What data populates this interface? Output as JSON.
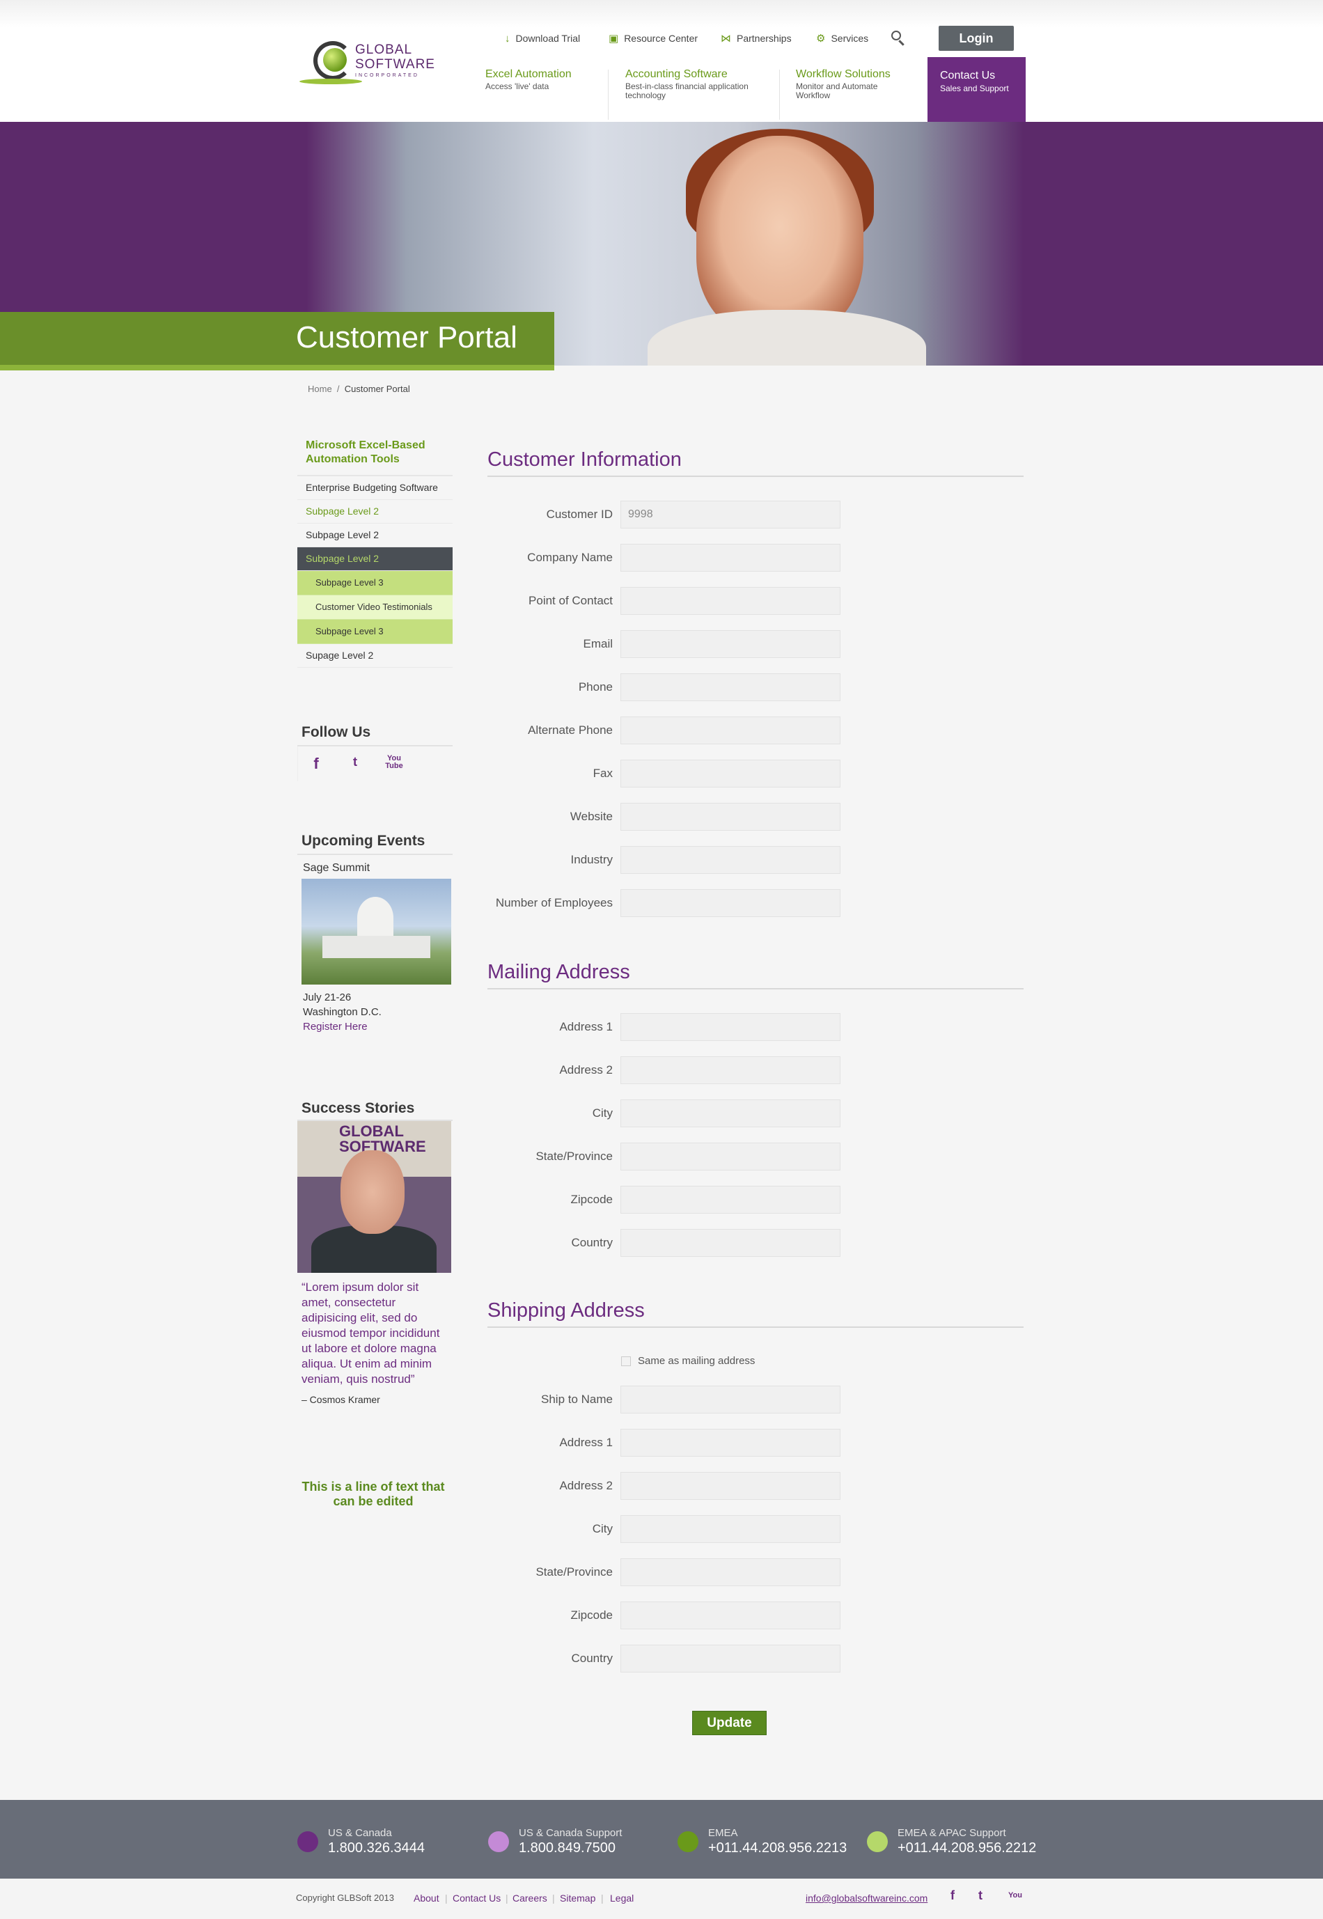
{
  "header": {
    "logo": {
      "line1": "GLOBAL",
      "line2": "SOFTWARE",
      "line3": "INCORPORATED"
    },
    "top_links": [
      {
        "label": "Download Trial",
        "icon": "download-icon"
      },
      {
        "label": "Resource Center",
        "icon": "box-icon"
      },
      {
        "label": "Partnerships",
        "icon": "handshake-icon"
      },
      {
        "label": "Services",
        "icon": "gears-icon"
      }
    ],
    "login_label": "Login",
    "nav": [
      {
        "title": "Excel Automation",
        "sub": "Access 'live' data"
      },
      {
        "title": "Accounting Software",
        "sub": "Best-in-class financial application technology"
      },
      {
        "title": "Workflow Solutions",
        "sub": "Monitor and Automate Workflow"
      },
      {
        "title": "Contact Us",
        "sub": "Sales and Support"
      }
    ]
  },
  "hero": {
    "title": "Customer Portal"
  },
  "breadcrumb": {
    "home": "Home",
    "sep": "/",
    "current": "Customer Portal"
  },
  "sidebar": {
    "heading": "Microsoft Excel-Based Automation Tools",
    "items": [
      {
        "label": "Enterprise Budgeting Software"
      },
      {
        "label": "Subpage Level 2"
      },
      {
        "label": "Subpage Level 2"
      },
      {
        "label": "Subpage Level 2"
      },
      {
        "label": "Subpage Level 3"
      },
      {
        "label": "Customer Video Testimonials"
      },
      {
        "label": "Subpage Level 3"
      },
      {
        "label": "Supage Level 2"
      }
    ],
    "follow": {
      "title": "Follow Us",
      "facebook": "f",
      "twitter": "t",
      "youtube_top": "You",
      "youtube_bottom": "Tube"
    },
    "events": {
      "title": "Upcoming Events",
      "name": "Sage Summit",
      "date": "July 21-26",
      "location": "Washington D.C.",
      "link": "Register Here"
    },
    "stories": {
      "title": "Success Stories",
      "banner": "GLOBAL SOFTWARE",
      "quote": "“Lorem ipsum dolor sit amet, consectetur adipisicing elit, sed do eiusmod tempor incididunt ut labore et dolore magna aliqua. Ut enim ad minim veniam, quis nostrud”",
      "author": "– Cosmos Kramer"
    },
    "editable_line": "This is a line of text that can be edited"
  },
  "form": {
    "customer": {
      "title": "Customer Information",
      "fields": [
        {
          "label": "Customer ID",
          "value": "9998"
        },
        {
          "label": "Company Name",
          "value": ""
        },
        {
          "label": "Point of Contact",
          "value": ""
        },
        {
          "label": "Email",
          "value": ""
        },
        {
          "label": "Phone",
          "value": ""
        },
        {
          "label": "Alternate Phone",
          "value": ""
        },
        {
          "label": "Fax",
          "value": ""
        },
        {
          "label": "Website",
          "value": ""
        },
        {
          "label": "Industry",
          "value": ""
        },
        {
          "label": "Number of Employees",
          "value": ""
        }
      ]
    },
    "mailing": {
      "title": "Mailing Address",
      "fields": [
        {
          "label": "Address 1"
        },
        {
          "label": "Address 2"
        },
        {
          "label": "City"
        },
        {
          "label": "State/Province"
        },
        {
          "label": "Zipcode"
        },
        {
          "label": "Country"
        }
      ]
    },
    "shipping": {
      "title": "Shipping Address",
      "same_as_label": "Same as mailing address",
      "fields": [
        {
          "label": "Ship to Name"
        },
        {
          "label": "Address 1"
        },
        {
          "label": "Address 2"
        },
        {
          "label": "City"
        },
        {
          "label": "State/Province"
        },
        {
          "label": "Zipcode"
        },
        {
          "label": "Country"
        }
      ]
    },
    "submit_label": "Update"
  },
  "footer": {
    "contacts": [
      {
        "label": "US & Canada",
        "number": "1.800.326.3444",
        "color": "#6c2c80"
      },
      {
        "label": "US & Canada Support",
        "number": "1.800.849.7500",
        "color": "#c48ad6"
      },
      {
        "label": "EMEA",
        "number": "+011.44.208.956.2213",
        "color": "#6a9a1a"
      },
      {
        "label": "EMEA & APAC Support",
        "number": "+011.44.208.956.2212",
        "color": "#b5d86a"
      }
    ],
    "copyright": "Copyright GLBSoft 2013",
    "links": [
      "About",
      "Contact Us",
      "Careers",
      "Sitemap",
      "Legal"
    ],
    "email": "info@globalsoftwareinc.com",
    "social": {
      "facebook": "f",
      "twitter": "t",
      "youtube": "You"
    }
  },
  "colors": {
    "purple": "#6c2c80",
    "green": "#6a9a1a",
    "dark_gray": "#5e6469"
  }
}
